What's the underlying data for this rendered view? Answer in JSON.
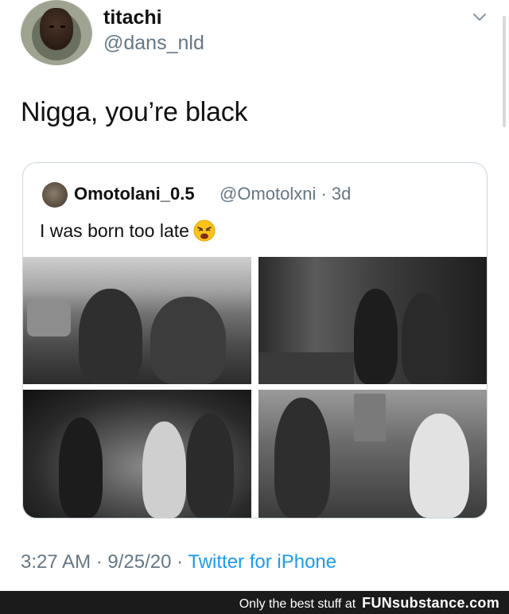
{
  "tweet": {
    "display_name": "titachi",
    "handle": "@dans_nld",
    "text": "Nigga, you’re black",
    "timestamp": "3:27 AM · 9/25/20 · ",
    "source": "Twitter for iPhone"
  },
  "quoted_tweet": {
    "display_name": "Omotolani_0.5",
    "handle_and_age": "@Omotolxni · 3d",
    "text": "I was born too late",
    "emoji": "weary-face-emoji"
  },
  "icons": {
    "menu": "chevron-down-icon"
  },
  "watermark": {
    "tagline": "Only the best stuff at",
    "brand": "FUNsubstance.com"
  },
  "colors": {
    "secondary_text": "#657786",
    "link": "#1d9bf0",
    "border": "#ccd6dd",
    "banner_bg": "#1b1b1b"
  }
}
